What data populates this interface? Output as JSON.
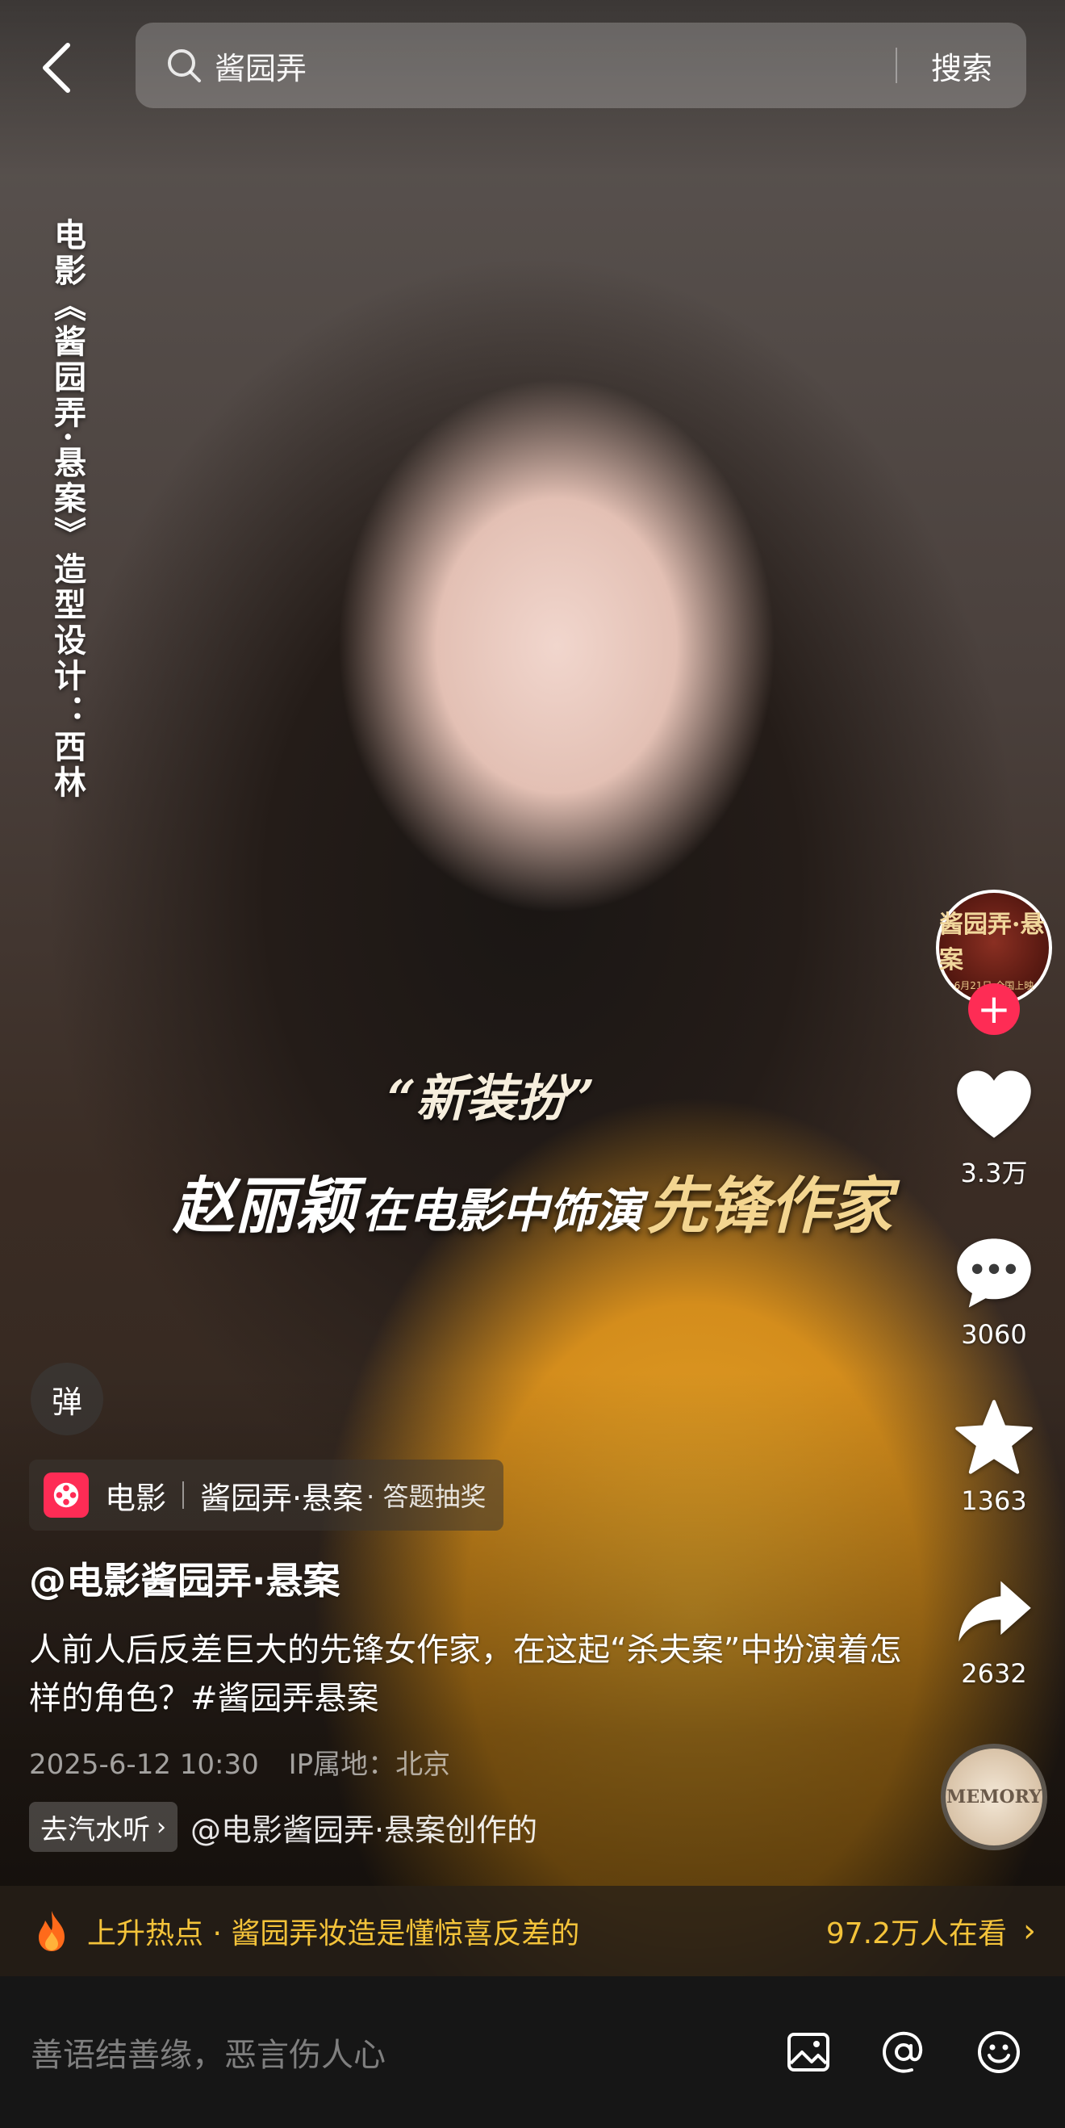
{
  "search": {
    "query": "酱园弄",
    "button_label": "搜索"
  },
  "video": {
    "vertical_credit": "电影《酱园弄·悬案》造型设计：西林",
    "caption_top": "“新装扮”",
    "caption_name": "赵丽颖",
    "caption_mid": "在电影中饰演",
    "caption_role": "先锋作家"
  },
  "sidebar": {
    "avatar_title": "酱园弄·悬案",
    "avatar_subtitle": "6月21日 全国上映",
    "follow_label": "+",
    "like_count": "3.3万",
    "comment_count": "3060",
    "favorite_count": "1363",
    "share_count": "2632",
    "music_disc_text": "MEMORY"
  },
  "danmu": {
    "label": "弹"
  },
  "tag": {
    "category": "电影",
    "title": "酱园弄·悬案",
    "extra": "· 答题抽奖"
  },
  "post": {
    "author": "@电影酱园弄·悬案",
    "description": "人前人后反差巨大的先锋女作家，在这起“杀夫案”中扮演着怎样的角色？#酱园弄悬案",
    "date": "2025-6-12 10:30",
    "ip_location": "IP属地：北京"
  },
  "source": {
    "chip_label": "去汽水听",
    "text": "@电影酱园弄·悬案创作的"
  },
  "hot": {
    "text": "上升热点 · 酱园弄妆造是懂惊喜反差的",
    "count": "97.2万人在看"
  },
  "comment_bar": {
    "placeholder": "善语结善缘，恶言伤人心"
  },
  "colors": {
    "accent_red": "#fe2c55",
    "hot_yellow": "#f4c33a"
  }
}
